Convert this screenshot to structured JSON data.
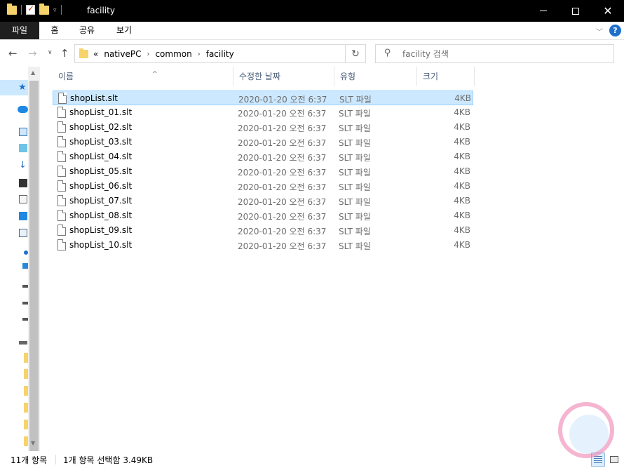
{
  "window": {
    "title": "facility"
  },
  "ribbon": {
    "tabs": [
      "파일",
      "홈",
      "공유",
      "보기"
    ],
    "help": "?"
  },
  "address": {
    "overflow": "«",
    "crumbs": [
      "nativePC",
      "common",
      "facility"
    ]
  },
  "search": {
    "placeholder": "facility 검색"
  },
  "columns": {
    "name": "이름",
    "date": "수정한 날짜",
    "type": "유형",
    "size": "크기"
  },
  "files": [
    {
      "name": "shopList.slt",
      "date": "2020-01-20 오전 6:37",
      "type": "SLT 파일",
      "size": "4KB",
      "selected": true
    },
    {
      "name": "shopList_01.slt",
      "date": "2020-01-20 오전 6:37",
      "type": "SLT 파일",
      "size": "4KB"
    },
    {
      "name": "shopList_02.slt",
      "date": "2020-01-20 오전 6:37",
      "type": "SLT 파일",
      "size": "4KB"
    },
    {
      "name": "shopList_03.slt",
      "date": "2020-01-20 오전 6:37",
      "type": "SLT 파일",
      "size": "4KB"
    },
    {
      "name": "shopList_04.slt",
      "date": "2020-01-20 오전 6:37",
      "type": "SLT 파일",
      "size": "4KB"
    },
    {
      "name": "shopList_05.slt",
      "date": "2020-01-20 오전 6:37",
      "type": "SLT 파일",
      "size": "4KB"
    },
    {
      "name": "shopList_06.slt",
      "date": "2020-01-20 오전 6:37",
      "type": "SLT 파일",
      "size": "4KB"
    },
    {
      "name": "shopList_07.slt",
      "date": "2020-01-20 오전 6:37",
      "type": "SLT 파일",
      "size": "4KB"
    },
    {
      "name": "shopList_08.slt",
      "date": "2020-01-20 오전 6:37",
      "type": "SLT 파일",
      "size": "4KB"
    },
    {
      "name": "shopList_09.slt",
      "date": "2020-01-20 오전 6:37",
      "type": "SLT 파일",
      "size": "4KB"
    },
    {
      "name": "shopList_10.slt",
      "date": "2020-01-20 오전 6:37",
      "type": "SLT 파일",
      "size": "4KB"
    }
  ],
  "status": {
    "count": "11개 항목",
    "selection": "1개 항목 선택함 3.49KB"
  },
  "colors": {
    "selection": "#cce8ff",
    "selection_border": "#99d1ff",
    "titlebar": "#000000",
    "folder": "#f6d36b",
    "help": "#1e6fcc"
  }
}
